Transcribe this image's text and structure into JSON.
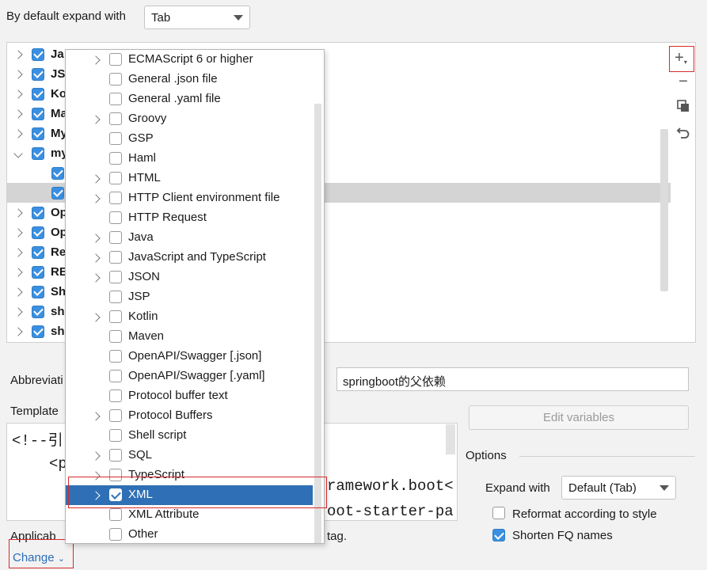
{
  "top": {
    "expand_label": "By default expand with",
    "expand_value": "Tab"
  },
  "tree": {
    "rows": [
      {
        "label": "Ja",
        "checked": true,
        "expand": "right"
      },
      {
        "label": "JS",
        "checked": true,
        "expand": "right"
      },
      {
        "label": "Ko",
        "checked": true,
        "expand": "right"
      },
      {
        "label": "Ma",
        "checked": true,
        "expand": "right"
      },
      {
        "label": "My",
        "checked": true,
        "expand": "right"
      },
      {
        "label": "my",
        "checked": true,
        "expand": "down"
      },
      {
        "label": "",
        "checked": true,
        "expand": "none"
      },
      {
        "label": "",
        "checked": true,
        "expand": "none"
      },
      {
        "label": "Op",
        "checked": true,
        "expand": "right"
      },
      {
        "label": "Op",
        "checked": true,
        "expand": "right"
      },
      {
        "label": "Re",
        "checked": true,
        "expand": "right"
      },
      {
        "label": "RE",
        "checked": true,
        "expand": "right"
      },
      {
        "label": "Sh",
        "checked": true,
        "expand": "right"
      },
      {
        "label": "sh",
        "checked": true,
        "expand": "right"
      },
      {
        "label": "sh",
        "checked": true,
        "expand": "right"
      }
    ]
  },
  "sidebar": {
    "add": "+",
    "remove": "−"
  },
  "popup": {
    "items": [
      {
        "label": "ECMAScript 6 or higher",
        "arrow": true,
        "checked": false
      },
      {
        "label": "General .json file",
        "arrow": false,
        "checked": false
      },
      {
        "label": "General .yaml file",
        "arrow": false,
        "checked": false
      },
      {
        "label": "Groovy",
        "arrow": true,
        "checked": false
      },
      {
        "label": "GSP",
        "arrow": false,
        "checked": false
      },
      {
        "label": "Haml",
        "arrow": false,
        "checked": false
      },
      {
        "label": "HTML",
        "arrow": true,
        "checked": false
      },
      {
        "label": "HTTP Client environment file",
        "arrow": true,
        "checked": false
      },
      {
        "label": "HTTP Request",
        "arrow": false,
        "checked": false
      },
      {
        "label": "Java",
        "arrow": true,
        "checked": false
      },
      {
        "label": "JavaScript and TypeScript",
        "arrow": true,
        "checked": false
      },
      {
        "label": "JSON",
        "arrow": true,
        "checked": false
      },
      {
        "label": "JSP",
        "arrow": false,
        "checked": false
      },
      {
        "label": "Kotlin",
        "arrow": true,
        "checked": false
      },
      {
        "label": "Maven",
        "arrow": false,
        "checked": false
      },
      {
        "label": "OpenAPI/Swagger [.json]",
        "arrow": false,
        "checked": false
      },
      {
        "label": "OpenAPI/Swagger [.yaml]",
        "arrow": false,
        "checked": false
      },
      {
        "label": "Protocol buffer text",
        "arrow": false,
        "checked": false
      },
      {
        "label": "Protocol Buffers",
        "arrow": true,
        "checked": false
      },
      {
        "label": "Shell script",
        "arrow": false,
        "checked": false
      },
      {
        "label": "SQL",
        "arrow": true,
        "checked": false
      },
      {
        "label": "TypeScript",
        "arrow": true,
        "checked": false
      },
      {
        "label": "XML",
        "arrow": true,
        "checked": true,
        "selected": true
      },
      {
        "label": "XML Attribute",
        "arrow": false,
        "checked": false
      },
      {
        "label": "Other",
        "arrow": false,
        "checked": false
      }
    ]
  },
  "form": {
    "abbrev_label": "Abbreviati",
    "description_value": "springboot的父依赖",
    "template_label": "Template",
    "edit_variables": "Edit variables",
    "code_line1": "<!--引",
    "code_line2": "<p",
    "code_right1": "ramework.boot<",
    "code_right2": "oot-starter-pa",
    "applicable_label": "Applicab",
    "applicable_tail": "tag.",
    "change_link": "Change"
  },
  "options": {
    "title": "Options",
    "expand_with_label": "Expand with",
    "expand_with_value": "Default (Tab)",
    "reformat_label": "Reformat according to style",
    "reformat_checked": false,
    "shorten_label": "Shorten FQ names",
    "shorten_checked": true
  }
}
